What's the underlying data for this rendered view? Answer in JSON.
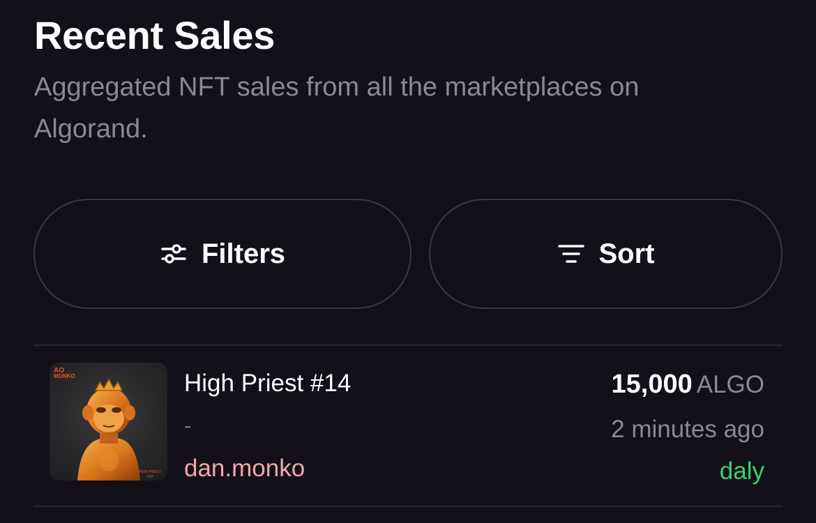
{
  "header": {
    "title": "Recent Sales",
    "subtitle": "Aggregated NFT sales from all the marketplaces on Algorand."
  },
  "controls": {
    "filters": {
      "label": "Filters",
      "icon": "sliders-icon"
    },
    "sort": {
      "label": "Sort",
      "icon": "sort-lines-icon"
    }
  },
  "sales": [
    {
      "name": "High Priest #14",
      "secondary": "-",
      "buyer": "dan.monko",
      "price": "15,000",
      "currency": "ALGO",
      "time": "2 minutes ago",
      "marketplace": "daly",
      "thumbnail": {
        "brand_text": "AO MONKO",
        "caption": "HIGH PRIEST #14"
      }
    }
  ],
  "colors": {
    "background": "#13101a",
    "muted_text": "#8b8893",
    "buyer_text": "#f4a7a7",
    "marketplace_text": "#3ad26a",
    "button_border": "#3a3742"
  }
}
